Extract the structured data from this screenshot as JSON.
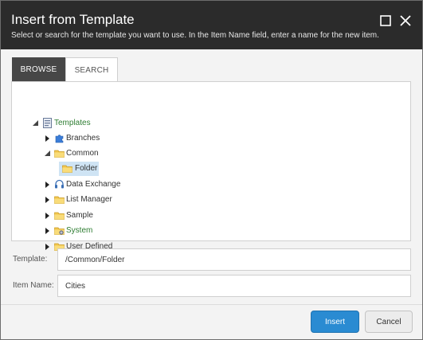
{
  "dialog": {
    "title": "Insert from Template",
    "subtitle": "Select or search for the template you want to use. In the Item Name field, enter a name for the new item."
  },
  "tabs": [
    {
      "label": "BROWSE",
      "active": true
    },
    {
      "label": "SEARCH",
      "active": false
    }
  ],
  "tree": {
    "root": {
      "label": "Templates",
      "icon": "template-list-icon",
      "expanded": true
    },
    "items": [
      {
        "label": "Branches",
        "icon": "puzzle-icon",
        "expanded": false
      },
      {
        "label": "Common",
        "icon": "folder-icon",
        "expanded": true
      },
      {
        "label": "Folder",
        "icon": "folder-icon",
        "selected": true
      },
      {
        "label": "Data Exchange",
        "icon": "headset-icon",
        "expanded": false
      },
      {
        "label": "List Manager",
        "icon": "folder-icon",
        "expanded": false
      },
      {
        "label": "Sample",
        "icon": "folder-icon",
        "expanded": false
      },
      {
        "label": "System",
        "icon": "system-folder-icon",
        "expanded": false
      },
      {
        "label": "User Defined",
        "icon": "folder-icon",
        "expanded": false
      }
    ]
  },
  "fields": {
    "template_label": "Template:",
    "template_value": "/Common/Folder",
    "item_name_label": "Item Name:",
    "item_name_value": "Cities"
  },
  "buttons": {
    "insert": "Insert",
    "cancel": "Cancel"
  },
  "colors": {
    "header_bg": "#2b2b2b",
    "accent": "#2a8bd2",
    "green_text": "#2e7d32",
    "selection": "#cfe4f4"
  }
}
